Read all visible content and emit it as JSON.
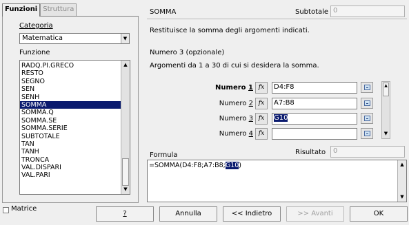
{
  "tabs": {
    "functions": "Funzioni",
    "structure": "Struttura"
  },
  "category": {
    "label": "Categoria",
    "selected": "Matematica"
  },
  "function_list": {
    "label": "Funzione",
    "items": [
      "RADQ.PI.GRECO",
      "RESTO",
      "SEGNO",
      "SEN",
      "SENH",
      "SOMMA",
      "SOMMA.Q",
      "SOMMA.SE",
      "SOMMA.SERIE",
      "SUBTOTALE",
      "TAN",
      "TANH",
      "TRONCA",
      "VAL.DISPARI",
      "VAL.PARI"
    ],
    "selected": "SOMMA"
  },
  "function": {
    "name": "SOMMA",
    "description": "Restituisce la somma degli argomenti indicati.",
    "subtotal_label": "Subtotale",
    "subtotal_value": "0",
    "arg_title": "Numero 3 (opzionale)",
    "arg_description": "Argomenti da 1 a 30 di cui si desidera la somma."
  },
  "arguments": [
    {
      "label_prefix": "Numero ",
      "label_key": "1",
      "value": "D4:F8"
    },
    {
      "label_prefix": "Numero ",
      "label_key": "2",
      "value": "A7:B8"
    },
    {
      "label_prefix": "Numero ",
      "label_key": "3",
      "value": "G10"
    },
    {
      "label_prefix": "Numero ",
      "label_key": "4",
      "value": ""
    }
  ],
  "fx_label": "fx",
  "formula": {
    "label": "Formula",
    "result_label": "Risultato",
    "result_value": "0",
    "text_before": "=SOMMA(D4:F8;A7:B8;",
    "text_selected": "G10",
    "text_after": ")"
  },
  "footer": {
    "matrix_label": "Matrice",
    "help": "?",
    "cancel": "Annulla",
    "back": "<< Indietro",
    "next": ">> Avanti",
    "ok": "OK"
  }
}
